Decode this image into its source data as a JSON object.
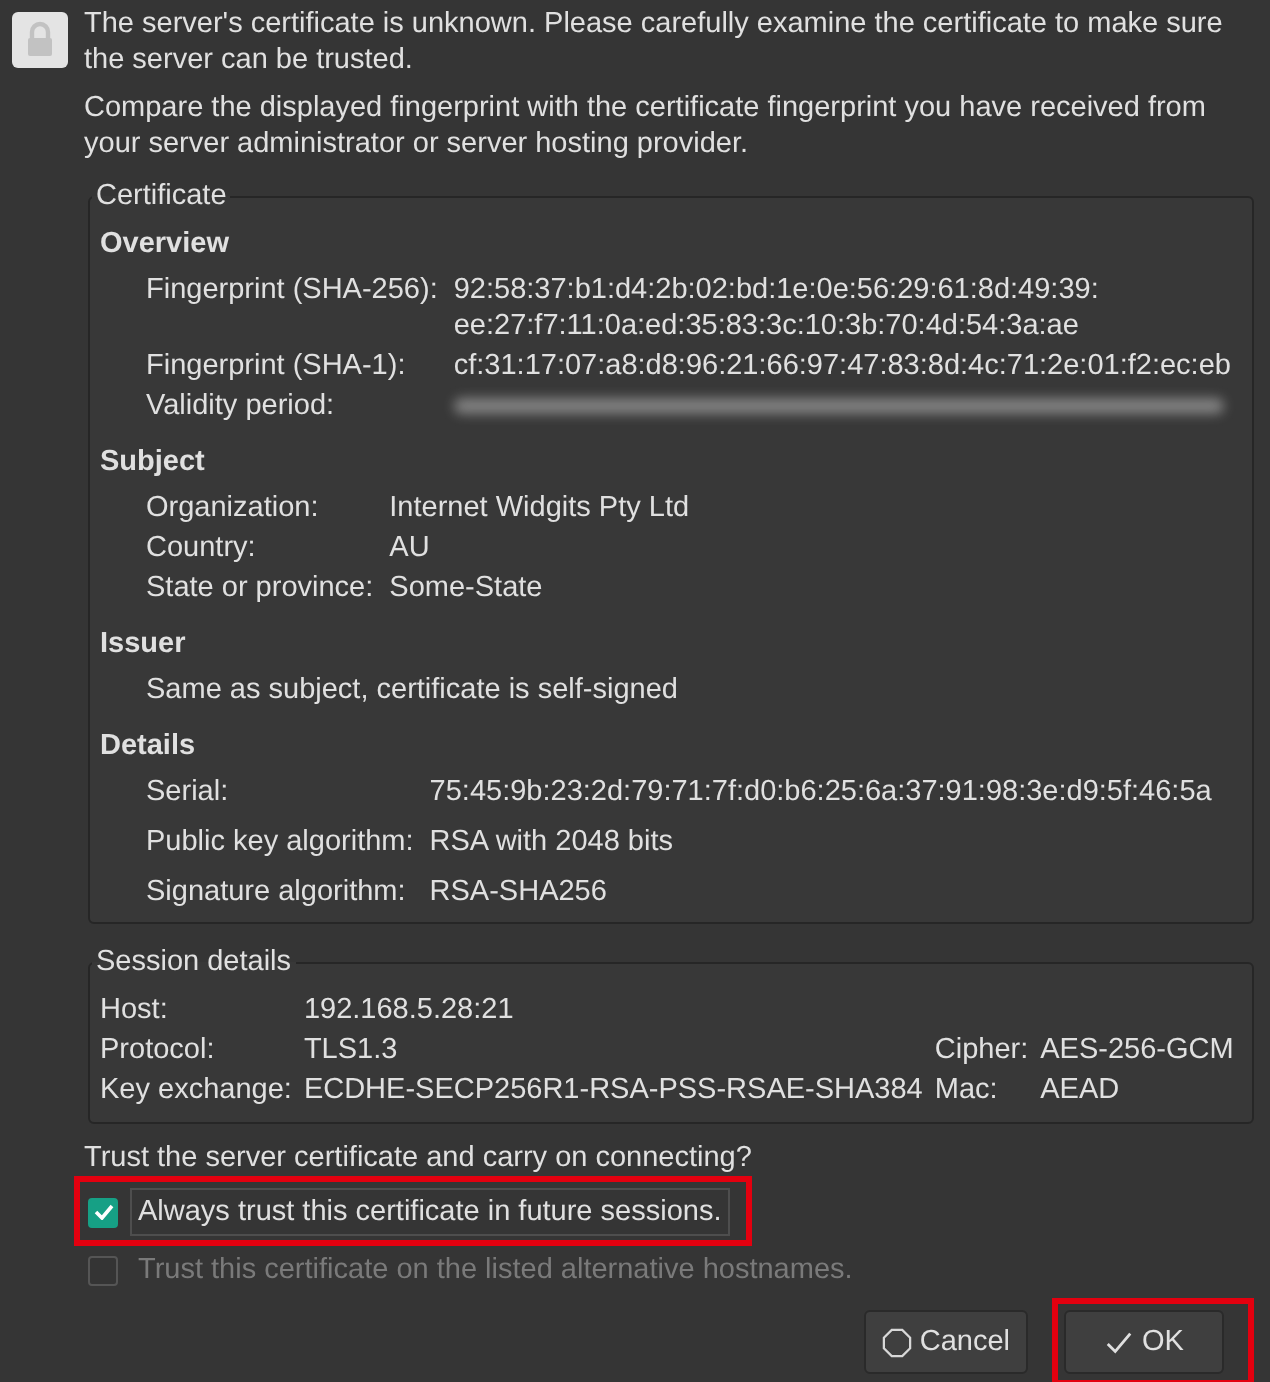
{
  "message": [
    "The server's certificate is unknown. Please carefully examine the certificate to make sure the server can be trusted.",
    "Compare the displayed fingerprint with the certificate fingerprint you have received from your server administrator or server hosting provider."
  ],
  "certificate": {
    "title": "Certificate",
    "sections": [
      {
        "heading": "Overview",
        "rows": [
          {
            "kind": "field",
            "label": "Fingerprint (SHA-256):",
            "value": "92:58:37:b1:d4:2b:02:bd:1e:0e:56:29:61:8d:49:39:\nee:27:f7:11:0a:ed:35:83:3c:10:3b:70:4d:54:3a:ae"
          },
          {
            "kind": "field",
            "label": "Fingerprint (SHA-1):",
            "value": "cf:31:17:07:a8:d8:96:21:66:97:47:83:8d:4c:71:2e:01:f2:ec:eb"
          },
          {
            "kind": "field",
            "label": "Validity period:",
            "redacted": true
          }
        ]
      },
      {
        "heading": "Subject",
        "rows": [
          {
            "kind": "field",
            "label": "Organization:",
            "value": "Internet Widgits Pty Ltd"
          },
          {
            "kind": "field",
            "label": "Country:",
            "value": "AU"
          },
          {
            "kind": "field",
            "label": "State or province:",
            "value": "Some-State"
          }
        ]
      },
      {
        "heading": "Issuer",
        "rows": [
          {
            "kind": "note",
            "text": "Same as subject, certificate is self-signed"
          }
        ]
      },
      {
        "heading": "Details",
        "rows": [
          {
            "kind": "field",
            "label": "Serial:",
            "value": "75:45:9b:23:2d:79:71:7f:d0:b6:25:6a:37:91:98:3e:d9:5f:46:5a"
          },
          {
            "kind": "field",
            "label": "Public key algorithm:",
            "value": "RSA with 2048 bits"
          },
          {
            "kind": "field",
            "label": "Signature algorithm:",
            "value": "RSA-SHA256"
          }
        ]
      }
    ]
  },
  "session": {
    "title": "Session details",
    "rows": [
      {
        "label": "Host:",
        "value": "192.168.5.28:21"
      },
      {
        "label": "Protocol:",
        "value": "TLS1.3",
        "extra_label": "Cipher:",
        "extra_value": "AES-256-GCM"
      },
      {
        "label": "Key exchange:",
        "value": "ECDHE-SECP256R1-RSA-PSS-RSAE-SHA384",
        "extra_label": "Mac:",
        "extra_value": "AEAD"
      }
    ]
  },
  "trust": {
    "question": "Trust the server certificate and carry on connecting?",
    "options": [
      {
        "label": "Always trust this certificate in future sessions.",
        "checked": true,
        "disabled": false,
        "focused": true,
        "highlighted": true
      },
      {
        "label": "Trust this certificate on the listed alternative hostnames.",
        "checked": false,
        "disabled": true,
        "focused": false,
        "highlighted": false
      }
    ]
  },
  "buttons": [
    {
      "kind": "cancel",
      "label": "Cancel",
      "highlighted": false
    },
    {
      "kind": "ok",
      "label": "OK",
      "highlighted": true
    }
  ]
}
